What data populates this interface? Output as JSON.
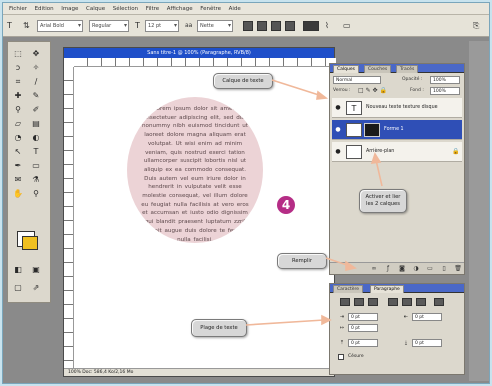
{
  "menubar": {
    "items": [
      "Fichier",
      "Edition",
      "Image",
      "Calque",
      "Sélection",
      "Filtre",
      "Affichage",
      "Fenêtre",
      "Aide"
    ]
  },
  "options": {
    "font_family": "Arial Bold",
    "font_style": "Regular",
    "font_size": "12 pt",
    "aa_mode": "Nette"
  },
  "document": {
    "title": "Sans titre-1 @ 100% (Paragraphe, RVB/8)",
    "status": "100%     Doc: 586,4 Ko/2,16 Mo",
    "circle_text": "Lorem ipsum dolor sit amet, consectetuer adipiscing elit, sed diam nonummy nibh euismod tincidunt ut laoreet dolore magna aliquam erat volutpat. Ut wisi enim ad minim veniam, quis nostrud exerci tation ullamcorper suscipit lobortis nisl ut aliquip ex ea commodo consequat. Duis autem vel eum iriure dolor in hendrerit in vulputate velit esse molestie consequat, vel illum dolore eu feugiat nulla facilisis at vero eros et accumsan et iusto odio dignissim qui blandit praesent luptatum zzril delenit augue duis dolore te feugait nulla facilisi."
  },
  "callouts": {
    "text_layer": "Calque de texte",
    "link_two": "Activer et lier les 2 calques",
    "fill": "Remplir",
    "text_box": "Plage de texte"
  },
  "badge": "4",
  "layers_panel": {
    "tabs": [
      "Calques",
      "Couches",
      "Tracés"
    ],
    "blend_mode": "Normal",
    "opacity_label": "Opacité :",
    "opacity_value": "100%",
    "lock_label": "Verrou :",
    "fill_label": "Fond :",
    "fill_value": "100%",
    "layers": [
      {
        "name": "Nouveau texte texture disque",
        "thumb": "T"
      },
      {
        "name": "Forme 1",
        "thumb": ""
      },
      {
        "name": "Arrière-plan",
        "thumb": ""
      }
    ]
  },
  "para_panel": {
    "tabs": [
      "Caractère",
      "Paragraphe"
    ],
    "fields": [
      "0 pt",
      "0 pt",
      "0 pt",
      "0 pt",
      "0 pt"
    ],
    "hyphen_label": "Césure"
  },
  "colors": {
    "title_bar": "#1f4fc9",
    "selected_layer": "#2f4fb6",
    "circle_fill": "#ecd3d6",
    "badge": "#b52d86",
    "arrow": "#f0b89a"
  }
}
